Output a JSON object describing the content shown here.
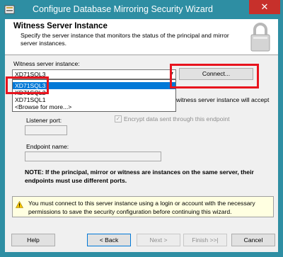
{
  "window": {
    "title": "Configure Database Mirroring Security Wizard",
    "close_glyph": "✕"
  },
  "header": {
    "title": "Witness Server Instance",
    "description": "Specify the server instance that monitors the status of the principal and mirror server instances."
  },
  "witness": {
    "label": "Witness server instance:",
    "selected_value": "XD71SQL3",
    "dropdown_options": [
      "XD71SQL3",
      "XD71SQL2",
      "XD71SQL1",
      "<Browse for more...>"
    ],
    "connect_label": "Connect..."
  },
  "partial_text": "witness server instance will accept",
  "encrypt_label": "Encrypt data sent through this endpoint",
  "listener_port_label": "Listener port:",
  "endpoint_name_label": "Endpoint name:",
  "note": "NOTE: If the principal, mirror or witness are instances on the same server, their endpoints must use different ports.",
  "warning": "You must connect to this server instance using a login or account with the necessary permissions to save the security configuration before continuing this wizard.",
  "buttons": {
    "help": "Help",
    "back": "< Back",
    "next": "Next >",
    "finish": "Finish >>|",
    "cancel": "Cancel"
  },
  "colors": {
    "titlebar": "#2e8ea3",
    "close": "#c7302b",
    "highlight": "#e8141e",
    "selection": "#0078d7"
  }
}
